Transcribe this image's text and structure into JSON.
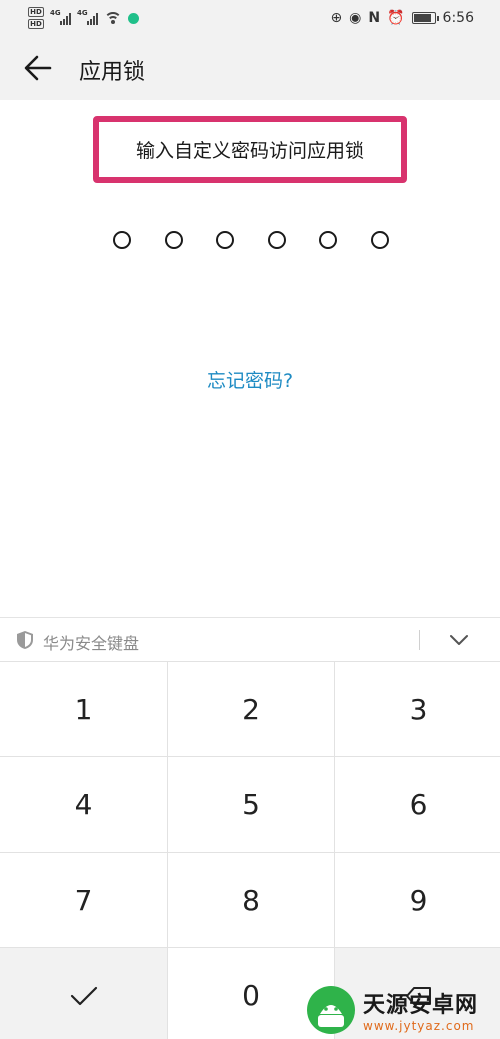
{
  "status_bar": {
    "hd_label": "HD",
    "net_1": "4G",
    "net_2": "4G",
    "time": "6:56",
    "battery_level": 0.8
  },
  "header": {
    "title": "应用锁"
  },
  "prompt": {
    "text": "输入自定义密码访问应用锁",
    "highlight_color": "#d8336e"
  },
  "pin": {
    "length": 6,
    "filled": 0
  },
  "forgot_link": "忘记密码?",
  "keyboard": {
    "label": "华为安全键盘",
    "keys": [
      [
        "1",
        "2",
        "3"
      ],
      [
        "4",
        "5",
        "6"
      ],
      [
        "7",
        "8",
        "9"
      ],
      [
        "",
        "0",
        ""
      ]
    ],
    "accent_link_color": "#1e8bc3"
  },
  "watermark": {
    "title": "天源安卓网",
    "url": "www.jytyaz.com"
  }
}
